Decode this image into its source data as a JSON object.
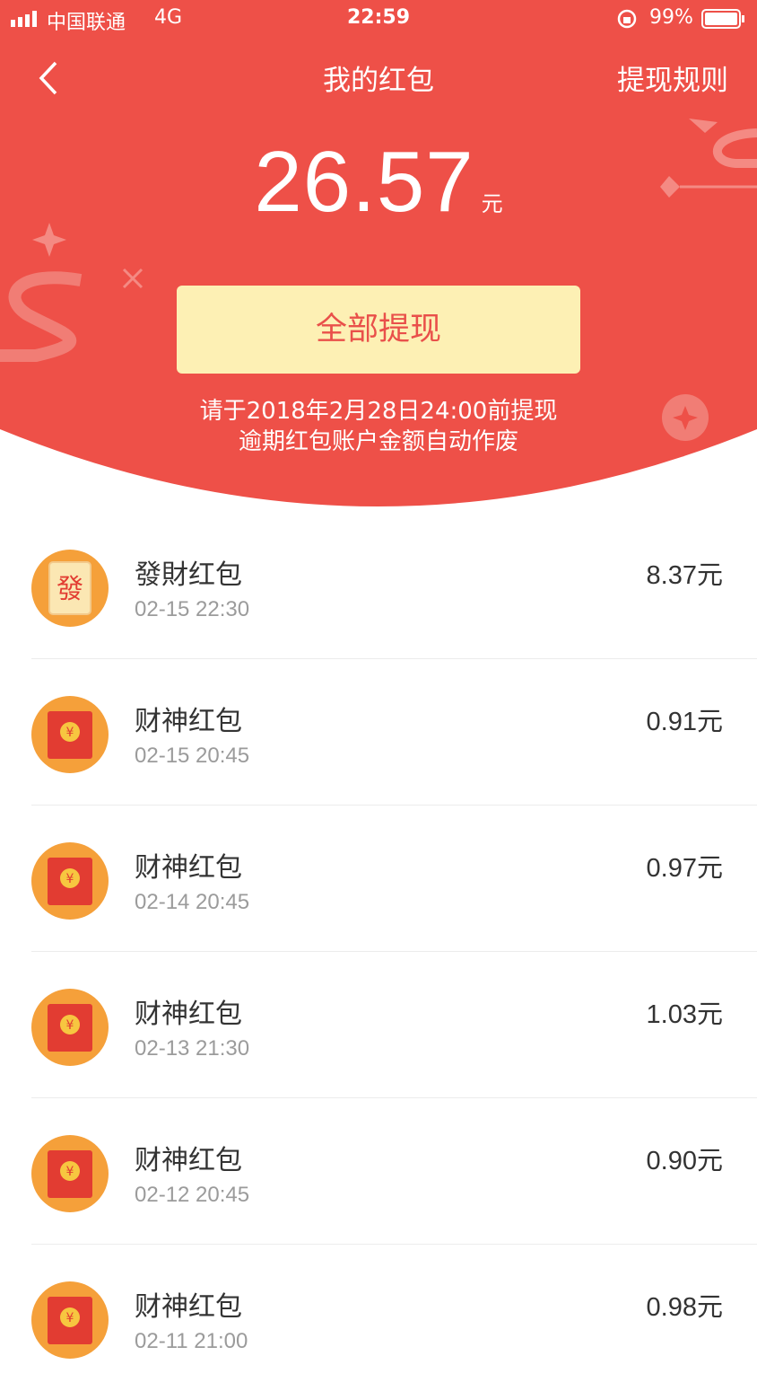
{
  "status_bar": {
    "carrier": "中国联通",
    "network": "4G",
    "time": "22:59",
    "battery": "99%"
  },
  "nav": {
    "title": "我的红包",
    "rules": "提现规则"
  },
  "balance": {
    "amount": "26.57",
    "unit": "元"
  },
  "withdraw_button": "全部提现",
  "notice": {
    "line1": "请于2018年2月28日24:00前提现",
    "line2": "逾期红包账户金额自动作废"
  },
  "records": [
    {
      "title": "發財红包",
      "time": "02-15 22:30",
      "amount": "8.37元",
      "icon": "fa-red-packet-icon",
      "icon_char": "發"
    },
    {
      "title": "财神红包",
      "time": "02-15 20:45",
      "amount": "0.91元",
      "icon": "red-envelope-icon",
      "icon_char": "¥"
    },
    {
      "title": "财神红包",
      "time": "02-14 20:45",
      "amount": "0.97元",
      "icon": "red-envelope-icon",
      "icon_char": "¥"
    },
    {
      "title": "财神红包",
      "time": "02-13 21:30",
      "amount": "1.03元",
      "icon": "red-envelope-icon",
      "icon_char": "¥"
    },
    {
      "title": "财神红包",
      "time": "02-12 20:45",
      "amount": "0.90元",
      "icon": "red-envelope-icon",
      "icon_char": "¥"
    },
    {
      "title": "财神红包",
      "time": "02-11 21:00",
      "amount": "0.98元",
      "icon": "red-envelope-icon",
      "icon_char": "¥"
    }
  ],
  "colors": {
    "header_red": "#ee5048",
    "button_yellow": "#fdf0b4",
    "icon_orange": "#f5a03a"
  }
}
